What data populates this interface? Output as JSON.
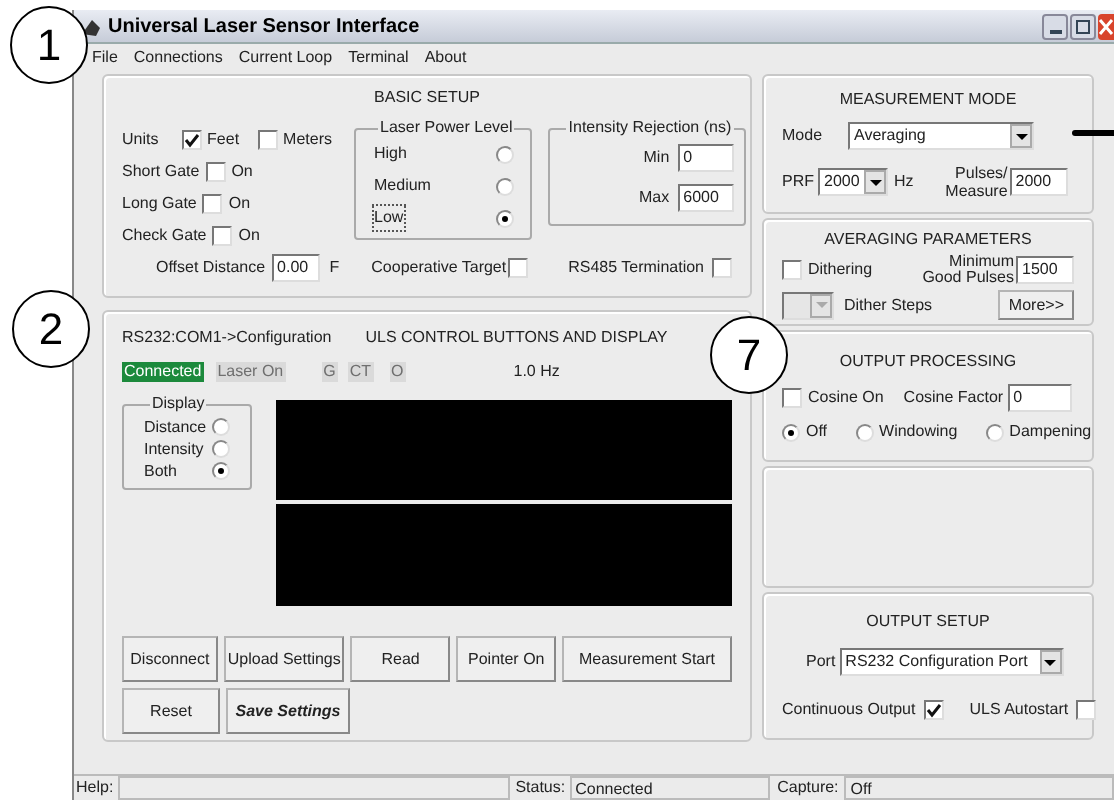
{
  "window": {
    "title": "Universal Laser Sensor Interface"
  },
  "menu": [
    "File",
    "Connections",
    "Current Loop",
    "Terminal",
    "About"
  ],
  "callouts": [
    "1",
    "2",
    "7"
  ],
  "basic_setup": {
    "title": "BASIC SETUP",
    "units": {
      "label": "Units",
      "options": [
        {
          "label": "Feet",
          "checked": true
        },
        {
          "label": "Meters",
          "checked": false
        }
      ]
    },
    "gates": [
      {
        "label": "Short Gate",
        "option": "On",
        "checked": false
      },
      {
        "label": "Long Gate",
        "option": "On",
        "checked": false
      },
      {
        "label": "Check Gate",
        "option": "On",
        "checked": false
      }
    ],
    "laser_power": {
      "title": "Laser Power Level",
      "options": [
        {
          "label": "High",
          "selected": false
        },
        {
          "label": "Medium",
          "selected": false
        },
        {
          "label": "Low",
          "selected": true
        }
      ]
    },
    "intensity_rejection": {
      "title": "Intensity Rejection (ns)",
      "fields": [
        {
          "label": "Min",
          "value": "0"
        },
        {
          "label": "Max",
          "value": "6000"
        }
      ]
    },
    "offset": {
      "label": "Offset Distance",
      "value": "0.00",
      "unit": "F"
    },
    "cooperative_target": {
      "label": "Cooperative Target",
      "checked": false
    },
    "rs485_termination": {
      "label": "RS485 Termination",
      "checked": false
    }
  },
  "control": {
    "connection": "RS232:COM1->Configuration",
    "title": "ULS CONTROL BUTTONS AND DISPLAY",
    "indicators": [
      {
        "label": "Connected",
        "on": true
      },
      {
        "label": "Laser On",
        "on": false
      },
      {
        "label": "G",
        "on": false
      },
      {
        "label": "CT",
        "on": false
      },
      {
        "label": "O",
        "on": false
      }
    ],
    "rate": "1.0 Hz",
    "display": {
      "title": "Display",
      "options": [
        {
          "label": "Distance",
          "selected": false
        },
        {
          "label": "Intensity",
          "selected": false
        },
        {
          "label": "Both",
          "selected": true
        }
      ]
    },
    "button_rows": [
      [
        {
          "label": "Disconnect",
          "kind": "normal"
        },
        {
          "label": "Upload Settings",
          "kind": "normal"
        },
        {
          "label": "Read",
          "kind": "normal"
        },
        {
          "label": "Pointer On",
          "kind": "normal"
        },
        {
          "label": "Measurement Start",
          "kind": "normal"
        }
      ],
      [
        {
          "label": "Reset",
          "kind": "normal"
        },
        {
          "label": "Save Settings",
          "kind": "emphasized"
        }
      ]
    ]
  },
  "measurement_mode": {
    "title": "MEASUREMENT MODE",
    "mode": {
      "label": "Mode",
      "value": "Averaging"
    },
    "prf": {
      "label": "PRF",
      "value": "2000",
      "unit": "Hz"
    },
    "pulses": {
      "label": "Pulses/ Measure",
      "value": "2000"
    }
  },
  "averaging_parameters": {
    "title": "AVERAGING PARAMETERS",
    "dithering": {
      "label": "Dithering",
      "checked": false
    },
    "min_good_pulses": {
      "label": "Minimum Good Pulses",
      "value": "1500"
    },
    "dither_steps": {
      "label": "Dither Steps",
      "disabled": true
    },
    "more_button": "More>>"
  },
  "output_processing": {
    "title": "OUTPUT PROCESSING",
    "cosine": {
      "label": "Cosine On",
      "checked": false
    },
    "cosine_factor": {
      "label": "Cosine Factor",
      "value": "0"
    },
    "modes": [
      {
        "label": "Off",
        "selected": true
      },
      {
        "label": "Windowing",
        "selected": false
      },
      {
        "label": "Dampening",
        "selected": false
      }
    ]
  },
  "output_setup": {
    "title": "OUTPUT SETUP",
    "port": {
      "label": "Port",
      "value": "RS232 Configuration Port"
    },
    "continuous_output": {
      "label": "Continuous Output",
      "checked": true
    },
    "uls_autostart": {
      "label": "ULS Autostart",
      "checked": false
    }
  },
  "status_bar": {
    "help_label": "Help:",
    "status_label": "Status:",
    "status": "Connected",
    "capture_label": "Capture:",
    "capture": "Off"
  }
}
